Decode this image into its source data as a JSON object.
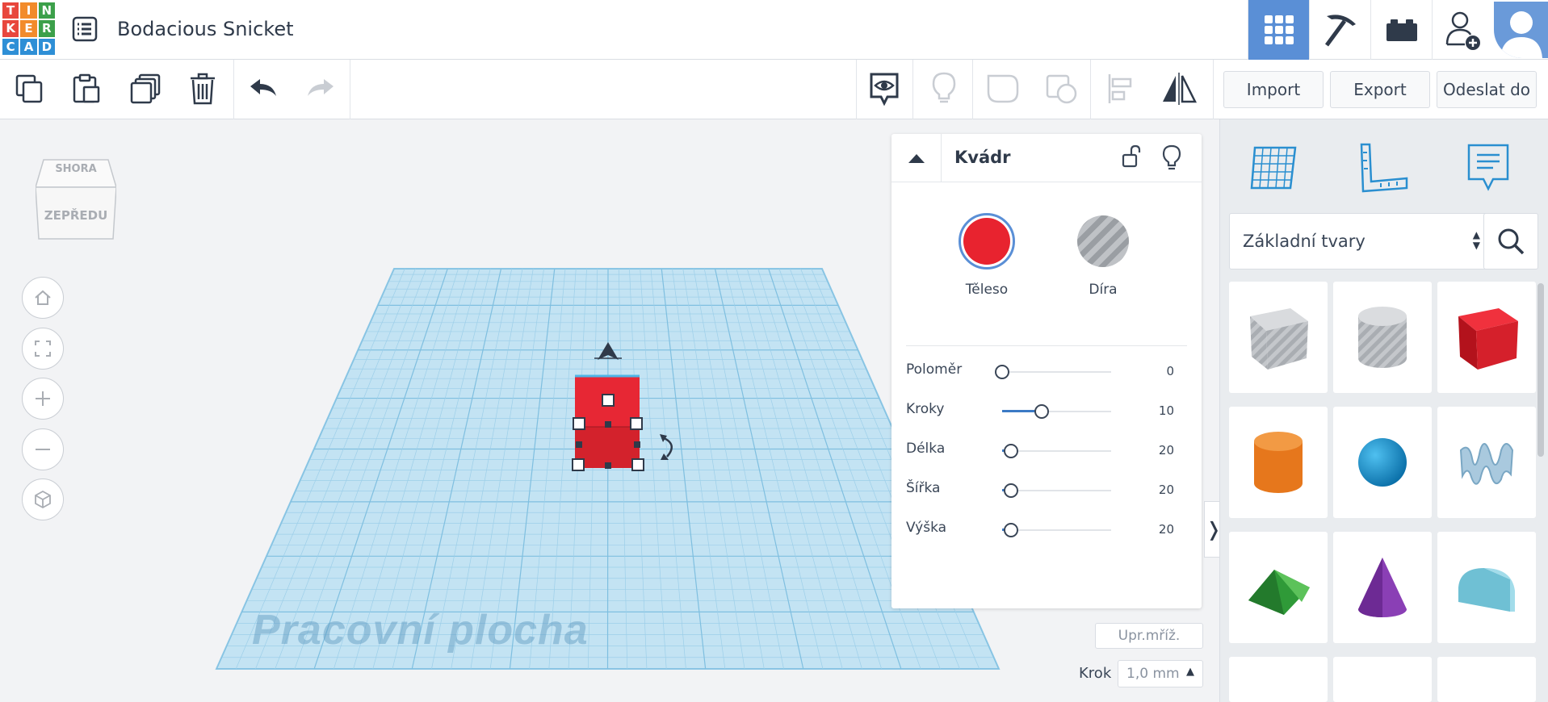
{
  "app": {
    "logo_letters": [
      "T",
      "I",
      "N",
      "K",
      "E",
      "R",
      "C",
      "A",
      "D"
    ],
    "logo_colors": [
      "#e8473d",
      "#f28b2b",
      "#3ca04a",
      "#e8473d",
      "#f28b2b",
      "#3ca04a",
      "#2e8fd6",
      "#2e8fd6",
      "#2e8fd6"
    ],
    "design_title": "Bodacious Snicket",
    "accent_color": "#5a8fd6"
  },
  "topbar": {
    "menu_icon": "list-icon",
    "view_buttons": [
      "grid-view-icon",
      "pickaxe-icon",
      "brick-icon",
      "add-user-icon"
    ],
    "avatar_icon": "user-avatar-icon"
  },
  "toolbar": {
    "left_tools": [
      "copy-icon",
      "paste-icon",
      "duplicate-icon",
      "trash-icon",
      "undo-icon",
      "redo-icon"
    ],
    "right_tools": [
      "eye-note-icon",
      "lightbulb-icon",
      "group-icon",
      "ungroup-icon",
      "align-icon",
      "mirror-icon"
    ],
    "import_label": "Import",
    "export_label": "Export",
    "send_label": "Odeslat do"
  },
  "viewcube": {
    "top_label": "SHORA",
    "front_label": "ZEPŘEDU"
  },
  "workplane": {
    "label": "Pracovní plocha",
    "grid_edit_label": "Upr.mříž.",
    "step_label": "Krok",
    "step_value": "1,0 mm"
  },
  "inspector": {
    "title": "Kvádr",
    "solid_label": "Těleso",
    "hole_label": "Díra",
    "solid_color": "#e8232f",
    "properties": [
      {
        "label": "Poloměr",
        "value": "0",
        "fraction": 0.0
      },
      {
        "label": "Kroky",
        "value": "10",
        "fraction": 0.36
      },
      {
        "label": "Délka",
        "value": "20",
        "fraction": 0.08
      },
      {
        "label": "Šířka",
        "value": "20",
        "fraction": 0.08
      },
      {
        "label": "Výška",
        "value": "20",
        "fraction": 0.08
      }
    ]
  },
  "shapes_panel": {
    "tabs": [
      "workplane-grid-icon",
      "ruler-icon",
      "notes-icon"
    ],
    "category": "Základní tvary",
    "shapes": [
      "box-hole-shape",
      "cylinder-hole-shape",
      "box-shape",
      "cylinder-shape",
      "sphere-shape",
      "scribble-shape",
      "roof-shape",
      "cone-shape",
      "round-roof-shape"
    ]
  }
}
